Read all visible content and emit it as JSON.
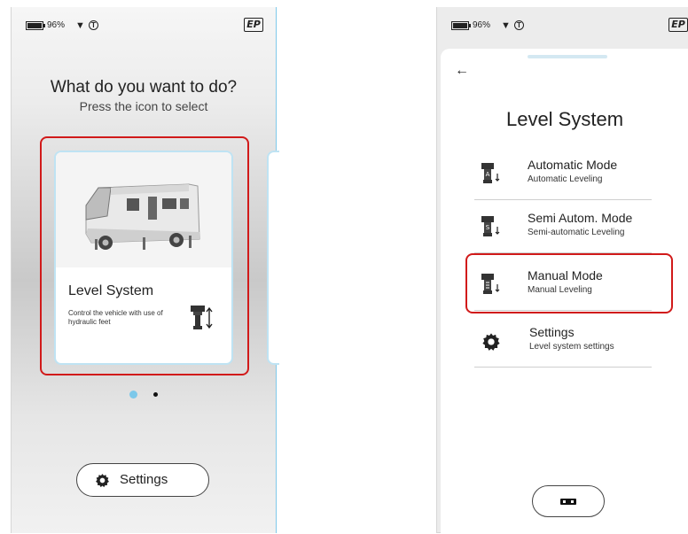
{
  "status_bar": {
    "battery_percent": "96%",
    "logo": "EP"
  },
  "left_screen": {
    "headline": "What do you want to do?",
    "subline": "Press the icon to select",
    "card": {
      "title": "Level System",
      "description": "Control the vehicle with use of hydraulic feet",
      "image_icon": "motorhome-icon",
      "feet_icon": "hydraulic-foot-icon"
    },
    "pager": {
      "active_page": 1,
      "page_count": 2
    },
    "settings_button_label": "Settings"
  },
  "right_screen": {
    "back_icon": "←",
    "title": "Level System",
    "menu": [
      {
        "title": "Automatic Mode",
        "subtitle": "Automatic Leveling",
        "icon": "jack-automatic-icon"
      },
      {
        "title": "Semi Autom. Mode",
        "subtitle": "Semi-automatic Leveling",
        "icon": "jack-semi-automatic-icon"
      },
      {
        "title": "Manual Mode",
        "subtitle": "Manual Leveling",
        "icon": "jack-manual-icon",
        "highlighted": true
      },
      {
        "title": "Settings",
        "subtitle": "Level system settings",
        "icon": "gear-icon"
      }
    ],
    "bottom_button_icon": "vehicle-top-view-icon"
  },
  "colors": {
    "highlight": "#d11a1a",
    "accent": "#7cc8ea",
    "card_border": "#bfe3f3"
  }
}
